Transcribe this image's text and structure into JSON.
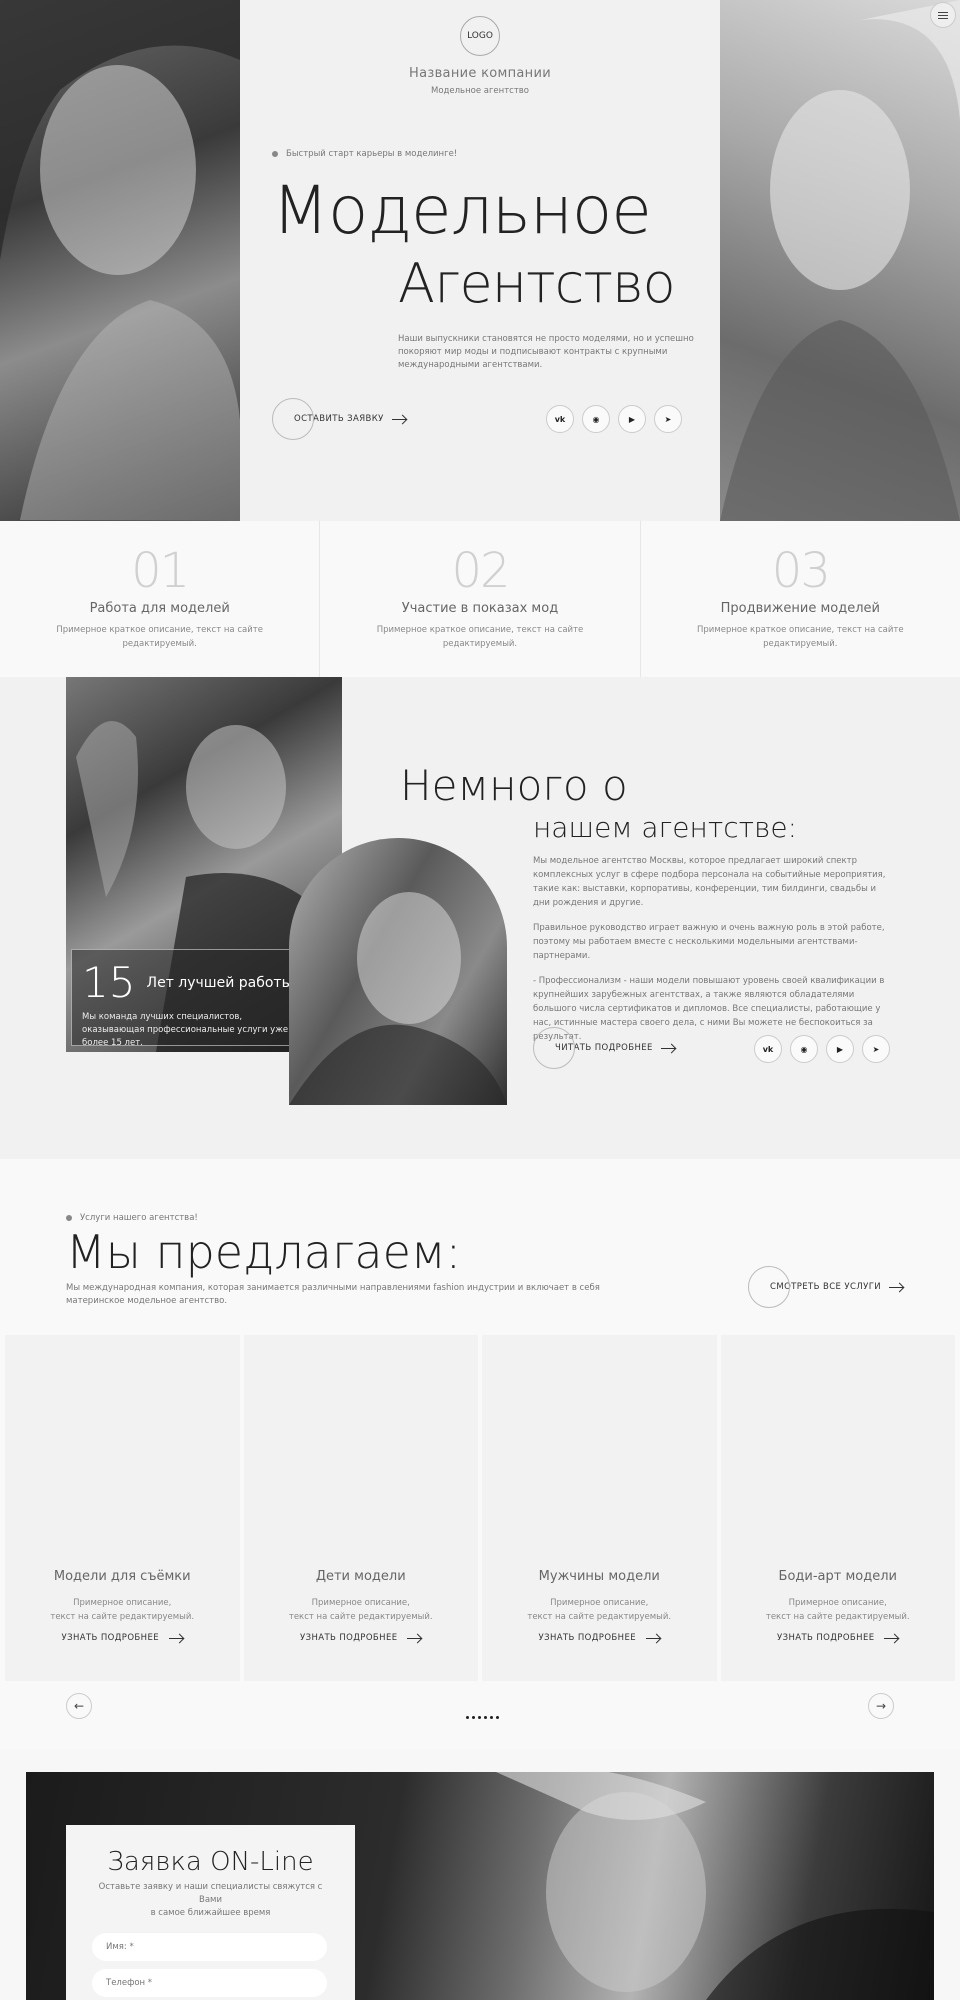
{
  "header": {
    "logo": "LOGO",
    "company_name": "Название компании",
    "company_sub": "Модельное агентство"
  },
  "hero": {
    "tagline": "Быстрый старт карьеры в моделинге!",
    "title_line1": "Модельное",
    "title_line2": "Агентство",
    "description": "Наши выпускники становятся не просто моделями, но и успешно покоряют мир моды и подписывают контракты с крупными международными агентствами.",
    "cta_label": "ОСТАВИТЬ ЗАЯВКУ"
  },
  "social": [
    {
      "icon": "vk-icon",
      "glyph": "vk"
    },
    {
      "icon": "whatsapp-icon",
      "glyph": "◉"
    },
    {
      "icon": "youtube-icon",
      "glyph": "▶"
    },
    {
      "icon": "telegram-icon",
      "glyph": "➤"
    }
  ],
  "features": [
    {
      "num": "01",
      "title": "Работа для моделей",
      "desc": "Примерное краткое описание, текст на сайте редактируемый."
    },
    {
      "num": "02",
      "title": "Участие в показах мод",
      "desc": "Примерное краткое описание, текст на сайте редактируемый."
    },
    {
      "num": "03",
      "title": "Продвижение моделей",
      "desc": "Примерное краткое описание, текст на сайте редактируемый."
    }
  ],
  "about": {
    "title_line1": "Немного о",
    "title_line2": "нашем агентстве:",
    "paragraphs": [
      "Мы модельное агентство Москвы, которое предлагает широкий спектр комплексных услуг в сфере подбора персонала на событийные мероприятия, такие как: выставки, корпоративы, конференции, тим билдинги, свадьбы и дни рождения и другие.",
      "Правильное руководство играет важную и очень важную роль в этой работе, поэтому мы работаем вместе с несколькими модельными агентствами-партнерами.",
      "- Профессионализм - наши модели повышают уровень своей квалификации в крупнейших зарубежных агентствах, а также являются обладателями большого числа сертификатов и дипломов. Все специалисты, работающие у нас, истинные мастера своего дела, с ними Вы можете не беспокоиться за результат."
    ],
    "years_number": "15",
    "years_label": "Лет лучшей работы!",
    "years_desc": "Мы команда лучших специалистов, оказывающая профессиональные услуги уже более 15 лет.",
    "read_more": "ЧИТАТЬ ПОДРОБНЕЕ"
  },
  "services": {
    "tag": "Услуги нашего агентства!",
    "title": "Мы предлагаем:",
    "description": "Мы международная компания, которая занимается различными направлениями fashion индустрии и включает в себя материнское модельное агентство.",
    "all_services": "СМОТРЕТЬ ВСЕ УСЛУГИ",
    "cards": [
      {
        "title": "Модели для съёмки",
        "desc1": "Примерное описание,",
        "desc2": "текст на сайте редактируемый.",
        "link": "УЗНАТЬ ПОДРОБНЕЕ"
      },
      {
        "title": "Дети модели",
        "desc1": "Примерное описание,",
        "desc2": "текст на сайте редактируемый.",
        "link": "УЗНАТЬ ПОДРОБНЕЕ"
      },
      {
        "title": "Мужчины модели",
        "desc1": "Примерное описание,",
        "desc2": "текст на сайте редактируемый.",
        "link": "УЗНАТЬ ПОДРОБНЕЕ"
      },
      {
        "title": "Боди-арт модели",
        "desc1": "Примерное описание,",
        "desc2": "текст на сайте редактируемый.",
        "link": "УЗНАТЬ ПОДРОБНЕЕ"
      }
    ],
    "prev": "←",
    "next": "→"
  },
  "contact": {
    "title": "Заявка ON-Line",
    "desc1": "Оставьте заявку и наши специалисты свяжутся с Вами",
    "desc2": "в самое ближайшее время",
    "name_placeholder": "Имя: *",
    "phone_placeholder": "Телефон *"
  }
}
